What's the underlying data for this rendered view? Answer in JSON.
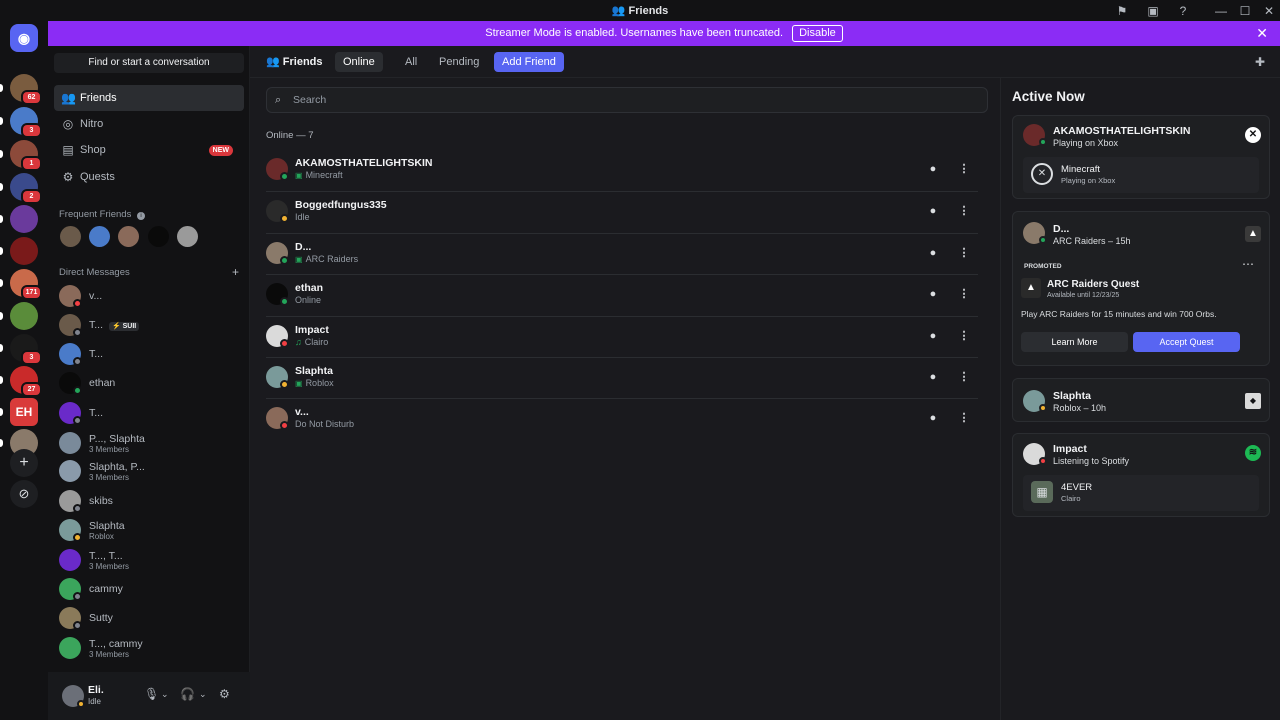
{
  "window": {
    "title": "Friends"
  },
  "banner": {
    "text": "Streamer Mode is enabled. Usernames have been truncated.",
    "button": "Disable"
  },
  "servers": [
    {
      "badge": "62",
      "color": "#7a5c3f"
    },
    {
      "badge": "3",
      "color": "#4a7bc9"
    },
    {
      "badge": "1",
      "color": "#8c4a3a"
    },
    {
      "badge": "2",
      "color": "#3a4a8c"
    },
    {
      "badge": "",
      "color": "#6a3a9c"
    },
    {
      "badge": "",
      "color": "#7a1a1a"
    },
    {
      "badge": "171",
      "color": "#c96a4a"
    },
    {
      "badge": "",
      "color": "#5a8c3a"
    },
    {
      "badge": "3",
      "color": "#1a1a1a"
    },
    {
      "badge": "27",
      "color": "#c92a2a"
    },
    {
      "badge": "",
      "color": "#d93a3a",
      "label": "EH"
    },
    {
      "badge": "",
      "color": "#8a7a6a"
    }
  ],
  "sidebar": {
    "search_placeholder": "Find or start a conversation",
    "nav": [
      {
        "label": "Friends",
        "icon": "friends-icon"
      },
      {
        "label": "Nitro",
        "icon": "nitro-icon"
      },
      {
        "label": "Shop",
        "icon": "shop-icon",
        "badge": "NEW"
      },
      {
        "label": "Quests",
        "icon": "quests-icon"
      }
    ],
    "frequent_friends_label": "Frequent Friends",
    "direct_messages_label": "Direct Messages",
    "dms": [
      {
        "name": "v...",
        "sub": "",
        "status": "#f23f43",
        "color": "#8a6a5a"
      },
      {
        "name": "T...",
        "sub": "",
        "tag": "⚡ SUII",
        "status": "#80848e",
        "color": "#6a5a4a"
      },
      {
        "name": "T...",
        "sub": "",
        "status": "#80848e",
        "color": "#4a7bc9"
      },
      {
        "name": "ethan",
        "sub": "",
        "status": "#23a55a",
        "color": "#0a0a0a"
      },
      {
        "name": "T...",
        "sub": "",
        "status": "#80848e",
        "color": "#6a2ac9"
      },
      {
        "name": "P..., Slaphta",
        "sub": "3 Members",
        "status": "",
        "color": "#7a8a9a"
      },
      {
        "name": "Slaphta, P...",
        "sub": "3 Members",
        "status": "",
        "color": "#8a9aaa"
      },
      {
        "name": "skibs",
        "sub": "",
        "status": "#80848e",
        "color": "#9a9a9a"
      },
      {
        "name": "Slaphta",
        "sub": "Roblox",
        "status": "#f0b232",
        "color": "#7a9a9a"
      },
      {
        "name": "T..., T...",
        "sub": "3 Members",
        "status": "",
        "color": "#6a2ac9"
      },
      {
        "name": "cammy",
        "sub": "",
        "status": "#80848e",
        "color": "#3ba55c"
      },
      {
        "name": "Sutty",
        "sub": "",
        "status": "#80848e",
        "color": "#8a7a5a"
      },
      {
        "name": "T..., cammy",
        "sub": "3 Members",
        "status": "",
        "color": "#3ba55c"
      }
    ],
    "user": {
      "name": "Eli.",
      "status": "Idle"
    }
  },
  "main": {
    "title": "Friends",
    "tabs": [
      "Online",
      "All",
      "Pending"
    ],
    "add_friend": "Add Friend",
    "search_placeholder": "Search",
    "online_header": "Online — 7",
    "friends": [
      {
        "name": "AKAMOSTHATELIGHTSKIN",
        "activity": "Minecraft",
        "status": "#23a55a",
        "color": "#6a2a2a",
        "game": true
      },
      {
        "name": "Boggedfungus335",
        "activity": "Idle",
        "status": "#f0b232",
        "color": "#2a2a2a",
        "game": false
      },
      {
        "name": "D...",
        "activity": "ARC Raiders",
        "status": "#23a55a",
        "color": "#8a7a6a",
        "game": true
      },
      {
        "name": "ethan",
        "activity": "Online",
        "status": "#23a55a",
        "color": "#0a0a0a",
        "game": false
      },
      {
        "name": "Impact",
        "activity": "Clairo",
        "status": "#f23f43",
        "color": "#dadada",
        "game": false,
        "music": true
      },
      {
        "name": "Slaphta",
        "activity": "Roblox",
        "status": "#f0b232",
        "color": "#7a9a9a",
        "game": true
      },
      {
        "name": "v...",
        "activity": "Do Not Disturb",
        "status": "#f23f43",
        "color": "#8a6a5a",
        "game": false
      }
    ]
  },
  "active_now": {
    "title": "Active Now",
    "cards": {
      "c1": {
        "name": "AKAMOSTHATELIGHTSKIN",
        "sub": "Playing on Xbox",
        "game": "Minecraft",
        "game_sub": "Playing on Xbox"
      },
      "c2": {
        "name": "D...",
        "sub": "ARC Raiders – 15h",
        "promoted": "PROMOTED",
        "quest_title": "ARC Raiders Quest",
        "quest_sub": "Available until 12/23/25",
        "quest_desc": "Play ARC Raiders for 15 minutes and win 700 Orbs.",
        "learn_more": "Learn More",
        "accept": "Accept Quest"
      },
      "c3": {
        "name": "Slaphta",
        "sub": "Roblox – 10h"
      },
      "c4": {
        "name": "Impact",
        "sub": "Listening to Spotify",
        "track": "4EVER",
        "artist": "Clairo"
      }
    }
  },
  "colors": {
    "accent": "#5865f2",
    "banner": "#8b2cf5",
    "online": "#23a55a",
    "idle": "#f0b232",
    "dnd": "#f23f43",
    "spotify": "#1db954"
  }
}
